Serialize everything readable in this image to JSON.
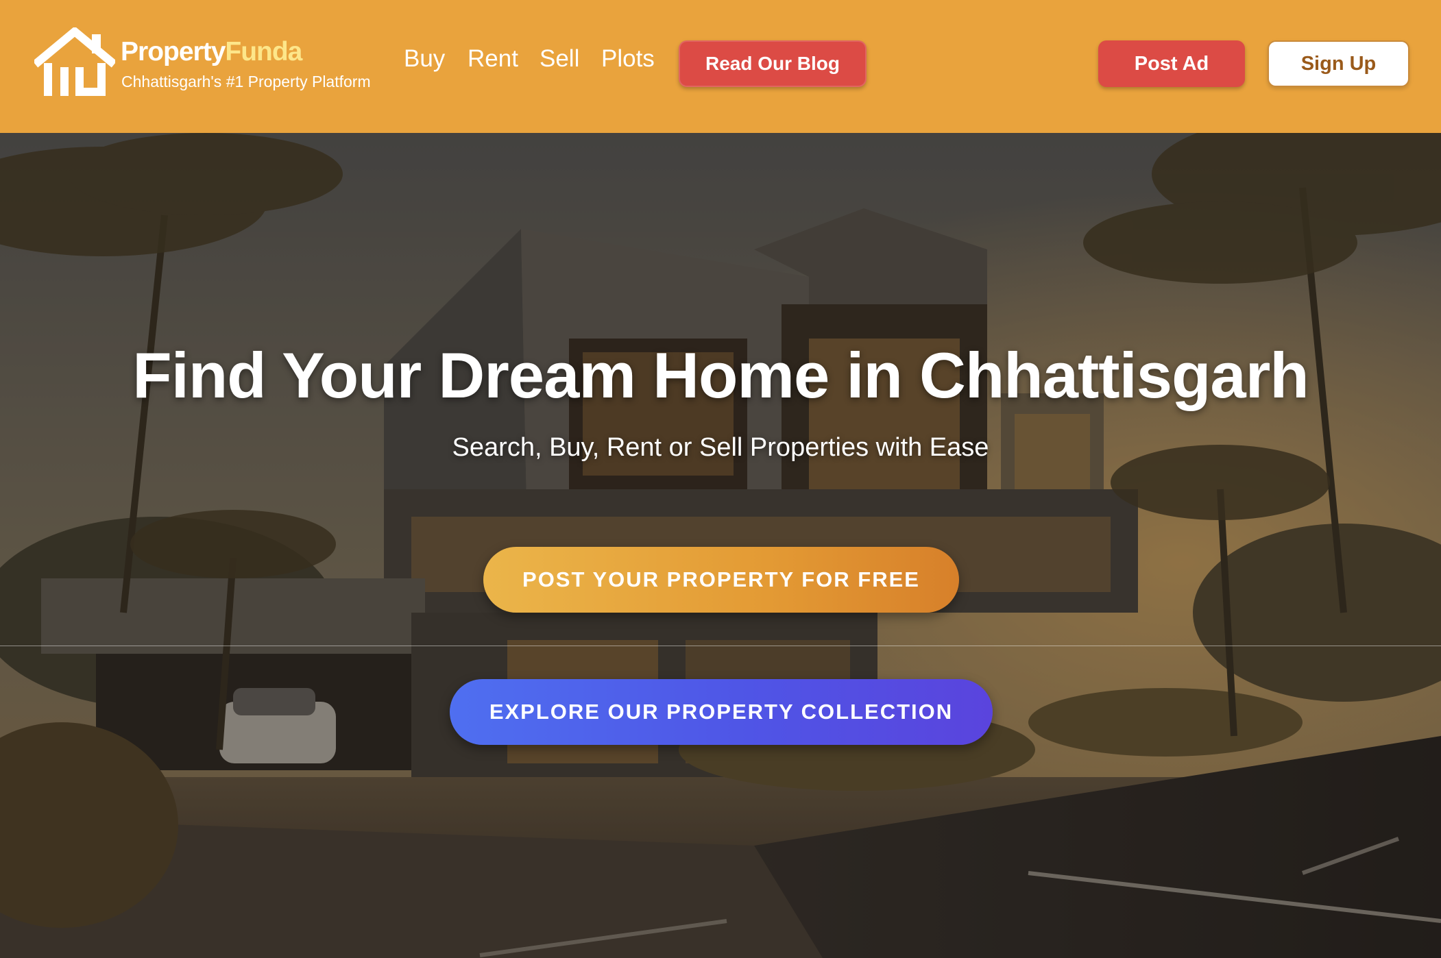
{
  "header": {
    "brand_primary": "Property",
    "brand_accent": "Funda",
    "tagline": "Chhattisgarh's #1 Property Platform",
    "logo_icon": "house-icon",
    "nav": {
      "buy": "Buy",
      "rent": "Rent",
      "sell": "Sell",
      "plots": "Plots"
    },
    "blog_button": "Read Our Blog",
    "post_ad_button": "Post Ad",
    "signup_button": "Sign Up"
  },
  "hero": {
    "title": "Find Your Dream Home in Chhattisgarh",
    "subtitle": "Search, Buy, Rent or Sell Properties with Ease",
    "cta_primary": "POST YOUR PROPERTY FOR FREE",
    "cta_secondary": "EXPLORE OUR PROPERTY COLLECTION"
  },
  "colors": {
    "header_bg": "#e9a33d",
    "brand_accent": "#fde68a",
    "red_button": "#dc4b45",
    "cta_orange": "#e39a34",
    "cta_blue": "#4f55e6"
  }
}
